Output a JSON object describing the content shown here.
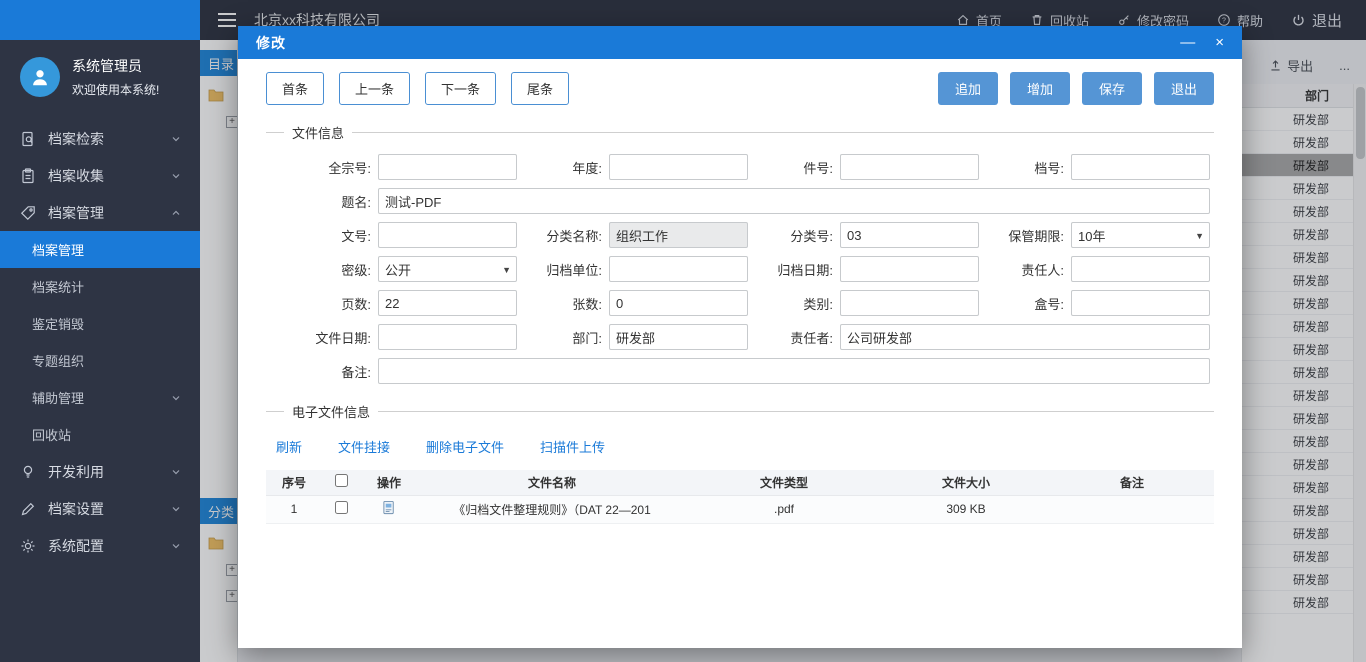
{
  "sidebar": {
    "user": {
      "name": "系统管理员",
      "welcome": "欢迎使用本系统!"
    },
    "menu": [
      {
        "label": "档案检索"
      },
      {
        "label": "档案收集"
      },
      {
        "label": "档案管理"
      },
      {
        "label": "开发利用"
      },
      {
        "label": "档案设置"
      },
      {
        "label": "系统配置"
      }
    ],
    "submenu": [
      {
        "label": "档案管理"
      },
      {
        "label": "档案统计"
      },
      {
        "label": "鉴定销毁"
      },
      {
        "label": "专题组织"
      },
      {
        "label": "辅助管理"
      },
      {
        "label": "回收站"
      }
    ]
  },
  "header": {
    "company": "北京xx科技有限公司",
    "menu": [
      {
        "label": "首页"
      },
      {
        "label": "回收站"
      },
      {
        "label": "修改密码"
      },
      {
        "label": "帮助"
      },
      {
        "label": "退出"
      }
    ]
  },
  "background": {
    "catalog_title": "目录",
    "category_title": "分类",
    "export_label": "导出",
    "more_label": "...",
    "table": {
      "header": "部门",
      "selected_index": 2,
      "rows": [
        "研发部",
        "研发部",
        "研发部",
        "研发部",
        "研发部",
        "研发部",
        "研发部",
        "研发部",
        "研发部",
        "研发部",
        "研发部",
        "研发部",
        "研发部",
        "研发部",
        "研发部",
        "研发部",
        "研发部",
        "研发部",
        "研发部",
        "研发部",
        "研发部",
        "研发部"
      ]
    }
  },
  "modal": {
    "title": "修改",
    "window_controls": {
      "minimize": "—",
      "close": "×"
    },
    "nav_buttons": [
      "首条",
      "上一条",
      "下一条",
      "尾条"
    ],
    "action_buttons": [
      "追加",
      "增加",
      "保存",
      "退出"
    ],
    "file_info": {
      "section_title": "文件信息",
      "fields": {
        "quanzong_no": {
          "label": "全宗号:",
          "value": ""
        },
        "year": {
          "label": "年度:",
          "value": ""
        },
        "item_no": {
          "label": "件号:",
          "value": ""
        },
        "dang_no": {
          "label": "档号:",
          "value": ""
        },
        "title": {
          "label": "题名:",
          "value": "测试-PDF"
        },
        "doc_no": {
          "label": "文号:",
          "value": ""
        },
        "category_name": {
          "label": "分类名称:",
          "value": "组织工作"
        },
        "category_no": {
          "label": "分类号:",
          "value": "03"
        },
        "retention": {
          "label": "保管期限:",
          "value": "10年"
        },
        "secrecy": {
          "label": "密级:",
          "value": "公开"
        },
        "filing_unit": {
          "label": "归档单位:",
          "value": ""
        },
        "filing_date": {
          "label": "归档日期:",
          "value": ""
        },
        "liable_person": {
          "label": "责任人:",
          "value": ""
        },
        "pages": {
          "label": "页数:",
          "value": "22"
        },
        "sheets": {
          "label": "张数:",
          "value": "0"
        },
        "kind": {
          "label": "类别:",
          "value": ""
        },
        "box_no": {
          "label": "盒号:",
          "value": ""
        },
        "file_date": {
          "label": "文件日期:",
          "value": ""
        },
        "department": {
          "label": "部门:",
          "value": "研发部"
        },
        "author": {
          "label": "责任者:",
          "value": "公司研发部"
        },
        "remark": {
          "label": "备注:",
          "value": ""
        }
      }
    },
    "efile": {
      "section_title": "电子文件信息",
      "actions": [
        "刷新",
        "文件挂接",
        "删除电子文件",
        "扫描件上传"
      ],
      "table": {
        "headers": {
          "no": "序号",
          "op": "操作",
          "name": "文件名称",
          "type": "文件类型",
          "size": "文件大小",
          "remark": "备注"
        },
        "row": {
          "no": "1",
          "name": "《归档文件整理规则》（DAT 22—201",
          "type": ".pdf",
          "size": "309 KB",
          "remark": ""
        }
      }
    }
  }
}
